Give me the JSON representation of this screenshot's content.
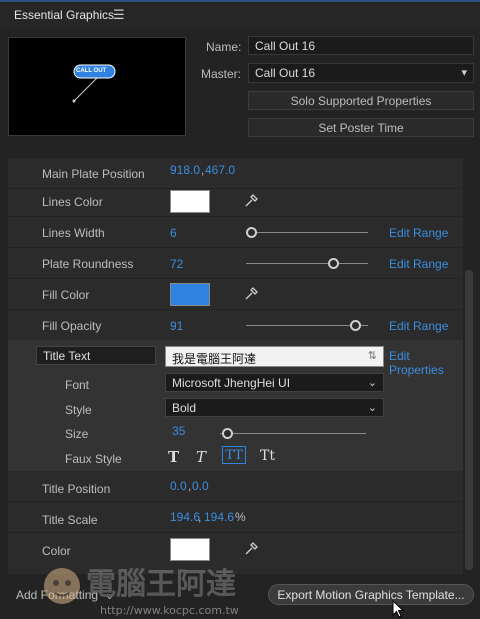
{
  "panel": {
    "title": "Essential Graphics",
    "menu_icon": "hamburger-icon"
  },
  "preview": {
    "callout_text": "CALL OUT"
  },
  "name_field": {
    "label": "Name:",
    "value": "Call Out 16"
  },
  "master_field": {
    "label": "Master:",
    "value": "Call Out 16"
  },
  "buttons": {
    "solo": "Solo Supported Properties",
    "poster": "Set Poster Time"
  },
  "properties": {
    "main_plate_position": {
      "label": "Main Plate Position",
      "x": "918.0",
      "y": "467.0"
    },
    "lines_color": {
      "label": "Lines Color",
      "color": "#ffffff"
    },
    "lines_width": {
      "label": "Lines Width",
      "value": "6",
      "slider_fraction": 0.06,
      "edit": "Edit Range"
    },
    "plate_roundness": {
      "label": "Plate Roundness",
      "value": "72",
      "slider_fraction": 0.72,
      "edit": "Edit Range"
    },
    "fill_color": {
      "label": "Fill Color",
      "color": "#2f82e0"
    },
    "fill_opacity": {
      "label": "Fill Opacity",
      "value": "91",
      "slider_fraction": 0.91,
      "edit": "Edit Range"
    },
    "title_text": {
      "label": "Title Text",
      "value": "我是電腦王阿達",
      "edit": "Edit Properties"
    },
    "font": {
      "label": "Font",
      "value": "Microsoft JhengHei UI"
    },
    "style": {
      "label": "Style",
      "value": "Bold"
    },
    "size": {
      "label": "Size",
      "value": "35",
      "slider_fraction": 0.05
    },
    "faux_style": {
      "label": "Faux Style",
      "options": [
        "T",
        "T",
        "TT",
        "Tt"
      ]
    },
    "title_position": {
      "label": "Title Position",
      "x": "0.0",
      "y": "0.0"
    },
    "title_scale": {
      "label": "Title Scale",
      "x": "194.6",
      "y": "194.6",
      "unit": "%"
    },
    "color": {
      "label": "Color",
      "color": "#ffffff"
    }
  },
  "footer": {
    "add_formatting": "Add Formatting",
    "export": "Export Motion Graphics Template..."
  },
  "watermark": {
    "text": "電腦王阿達",
    "url": "http://www.kocpc.com.tw"
  }
}
